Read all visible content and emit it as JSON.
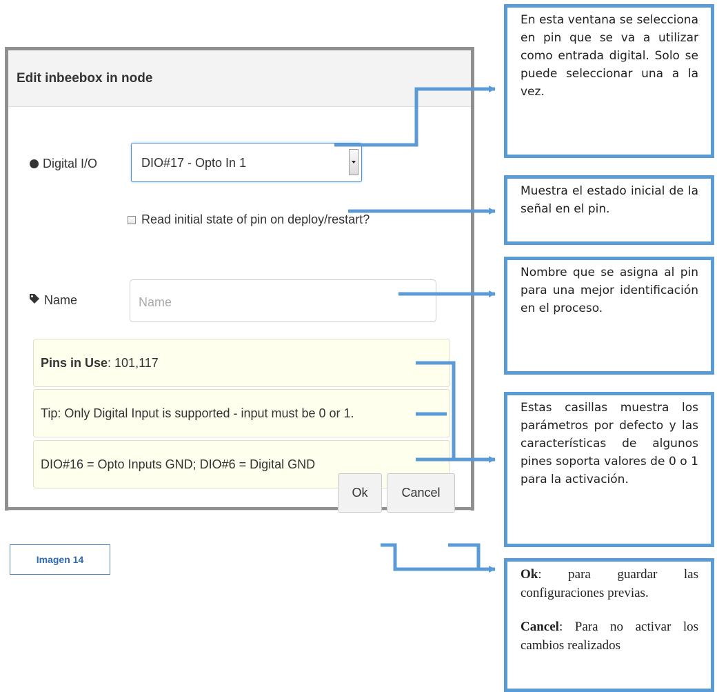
{
  "dialog": {
    "title": "Edit inbeebox in node",
    "digital_io_label": "Digital I/O",
    "digital_io_value": "DIO#17 - Opto In 1",
    "checkbox_label": "Read initial state of pin on deploy/restart?",
    "name_label": "Name",
    "name_placeholder": "Name",
    "pins_label": "Pins in Use",
    "pins_value": ": 101,117",
    "tip_text": "Tip: Only Digital Input is supported - input must be 0 or 1.",
    "gnd_text": "DIO#16 = Opto Inputs GND; DIO#6 = Digital GND",
    "ok_label": "Ok",
    "cancel_label": "Cancel"
  },
  "caption": "Imagen  14",
  "notes": {
    "note1": "En esta ventana se selecciona en pin que se va a utilizar como entrada digital. Solo se puede seleccionar una a la vez.",
    "note2": "Muestra el estado inicial de la señal en el pin.",
    "note3": "Nombre que se asigna al pin para una mejor identificación en el proceso.",
    "note4": "Estas casillas muestra los parámetros por defecto y las características de algunos pines soporta valores de 0 o 1 para la activación.",
    "note5_ok_bold": "Ok",
    "note5_ok_text": ": para guardar las configuraciones previas.",
    "note5_cancel_bold": "Cancel",
    "note5_cancel_text": ": Para no activar los cambios realizados"
  },
  "colors": {
    "accent": "#5b9bd5",
    "tip_bg": "#ffffed"
  }
}
